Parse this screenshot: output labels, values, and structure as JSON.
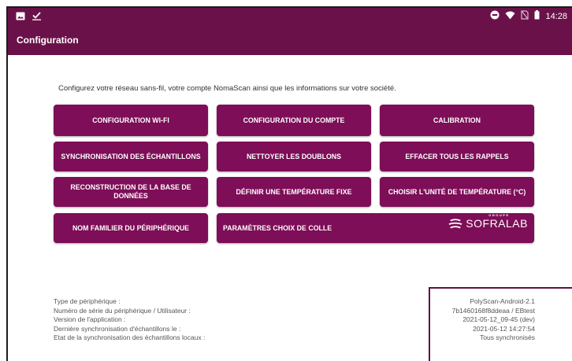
{
  "statusbar": {
    "time": "14:28"
  },
  "appbar": {
    "title": "Configuration"
  },
  "intro": "Configurez votre réseau sans-fil, votre compte NomaScan ainsi que les informations sur votre société.",
  "buttons": {
    "wifi": "CONFIGURATION WI-FI",
    "account": "CONFIGURATION DU COMPTE",
    "calibration": "CALIBRATION",
    "sync": "SYNCHRONISATION DES ÉCHANTILLONS",
    "dedupe": "NETTOYER LES DOUBLONS",
    "clear_reminders": "EFFACER TOUS LES RAPPELS",
    "rebuild_db": "RECONSTRUCTION DE LA BASE DE DONNÉES",
    "fixed_temp": "DÉFINIR UNE TEMPÉRATURE FIXE",
    "temp_unit": "CHOISIR L'UNITÉ DE TEMPÉRATURE (°C)",
    "device_name": "NOM FAMILIER DU PÉRIPHÉRIQUE",
    "glue": "PARAMÈTRES CHOIX DE COLLE"
  },
  "logo": {
    "group": "GROUPE",
    "name": "SOFRALAB"
  },
  "info": {
    "labels": [
      "Type de périphérique :",
      "Numéro de série du périphérique / Utilisateur :",
      "Version de l'application :",
      "Dernière synchronisation d'échantillons le :",
      "Etat de la synchronisation des échantillons locaux :"
    ],
    "values": [
      "PolyScan-Android-2.1",
      "7b1460168f8ddeaa / EBtest",
      "2021-05-12_09-45 (dev)",
      "2021-05-12 14:27:54",
      "Tous synchronisés"
    ]
  },
  "colors": {
    "primary": "#6b1149",
    "button": "#7d0e57"
  },
  "icons": [
    "image-icon",
    "check-icon",
    "dnd-icon",
    "wifi-icon",
    "no-sim-icon",
    "battery-icon"
  ]
}
